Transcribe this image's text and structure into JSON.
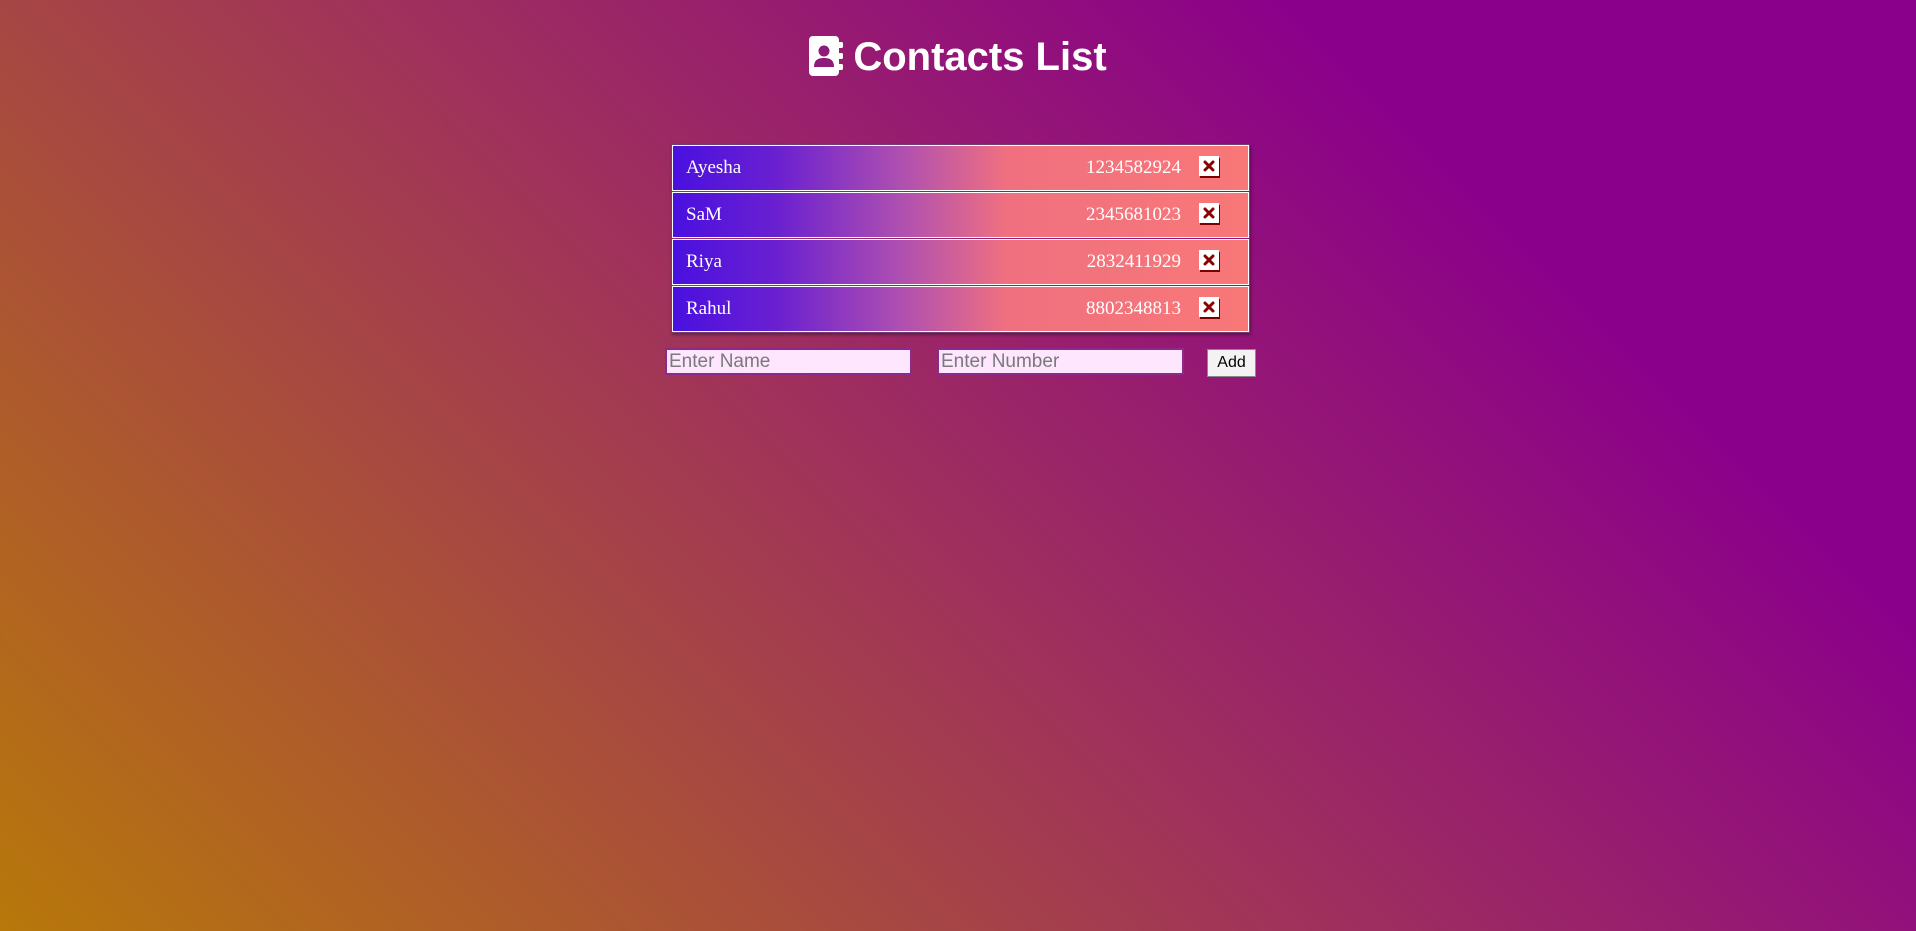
{
  "header": {
    "title": "Contacts List",
    "icon": "address-book-icon"
  },
  "contacts": [
    {
      "name": "Ayesha",
      "number": "1234582924"
    },
    {
      "name": "SaM",
      "number": "2345681023"
    },
    {
      "name": "Riya",
      "number": "2832411929"
    },
    {
      "name": "Rahul",
      "number": "8802348813"
    }
  ],
  "form": {
    "name_placeholder": "Enter Name",
    "name_value": "",
    "number_placeholder": "Enter Number",
    "number_value": "",
    "add_label": "Add"
  },
  "colors": {
    "delete_icon": "#8b0000",
    "row_gradient_start": "#4a10e0",
    "row_gradient_end": "#f87878",
    "input_background": "#ffe6ff"
  },
  "icons": {
    "delete": "close-square-icon"
  }
}
